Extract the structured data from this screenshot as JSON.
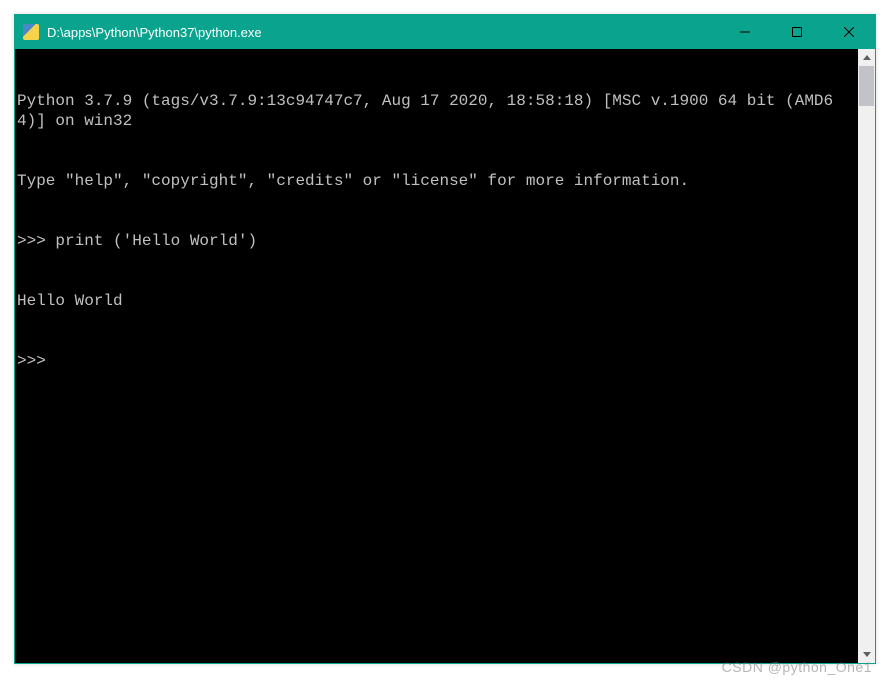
{
  "window": {
    "title": "D:\\apps\\Python\\Python37\\python.exe"
  },
  "terminal": {
    "lines": [
      "Python 3.7.9 (tags/v3.7.9:13c94747c7, Aug 17 2020, 18:58:18) [MSC v.1900 64 bit (AMD64)] on win32",
      "Type \"help\", \"copyright\", \"credits\" or \"license\" for more information.",
      ">>> print ('Hello World')",
      "Hello World",
      ">>>"
    ]
  },
  "watermark": "CSDN @python_One1"
}
